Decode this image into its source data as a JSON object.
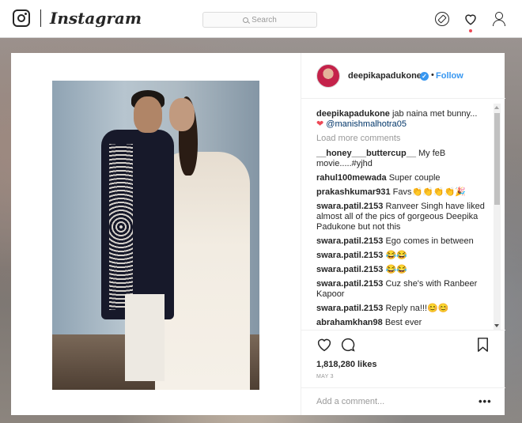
{
  "topbar": {
    "brand": "Instagram",
    "search_placeholder": "Search",
    "icons": [
      "instagram-logo-icon",
      "compass-icon",
      "heart-icon",
      "profile-icon"
    ],
    "notification_color": "#ed4956"
  },
  "post": {
    "username": "deepikapadukone",
    "verified": true,
    "follow_label": "Follow",
    "caption_user": "deepikapadukone",
    "caption_text": "jab naina met bunny...",
    "caption_heart": "❤",
    "caption_mention": "@manishmalhotra05",
    "load_more": "Load more comments",
    "comments": [
      {
        "user": "__honey___buttercup__",
        "text": "My feB movie.....#yjhd"
      },
      {
        "user": "rahul100mewada",
        "text": "Super couple"
      },
      {
        "user": "prakashkumar931",
        "text": "Favs👏👏👏👏🎉"
      },
      {
        "user": "swara.patil.2153",
        "text": "Ranveer Singh have liked almost all of the pics of gorgeous Deepika Padukone but not this"
      },
      {
        "user": "swara.patil.2153",
        "text": "Ego comes in between"
      },
      {
        "user": "swara.patil.2153",
        "text": "😂😂"
      },
      {
        "user": "swara.patil.2153",
        "text": "😂😂"
      },
      {
        "user": "swara.patil.2153",
        "text": "Cuz she's with Ranbeer Kapoor"
      },
      {
        "user": "swara.patil.2153",
        "text": "Reply na!!!😊😊"
      },
      {
        "user": "abrahamkhan98",
        "text": "Best ever"
      }
    ],
    "likes": "1,818,280 likes",
    "date": "MAY 3",
    "add_comment_placeholder": "Add a comment...",
    "more_label": "•••"
  },
  "colors": {
    "accent": "#3897f0",
    "heart": "#ed4956",
    "text": "#262626",
    "muted": "#999999"
  }
}
